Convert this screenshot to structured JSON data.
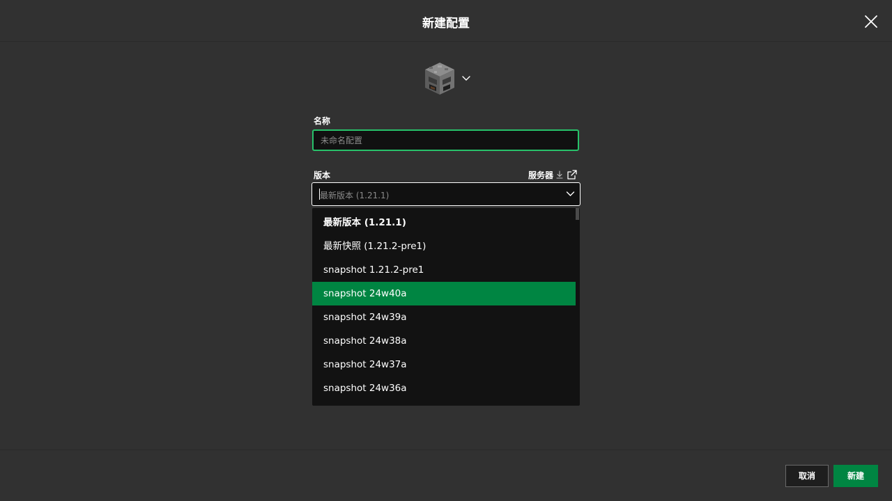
{
  "dialog": {
    "title": "新建配置"
  },
  "icons": {
    "close": "close-icon",
    "profile_block": "furnace-block-icon",
    "picker_chevron": "chevron-down-icon",
    "download": "download-icon",
    "external_link": "external-link-icon",
    "dropdown_chevron": "chevron-down-icon"
  },
  "form": {
    "name_label": "名称",
    "name_placeholder": "未命名配置",
    "name_value": "",
    "version_label": "版本",
    "server_label": "服务器",
    "version_placeholder": "最新版本 (1.21.1)"
  },
  "version_options": [
    {
      "label": "最新版本 (1.21.1)",
      "bold": true,
      "selected": false
    },
    {
      "label": "最新快照 (1.21.2-pre1)",
      "bold": false,
      "selected": false
    },
    {
      "label": "snapshot 1.21.2-pre1",
      "bold": false,
      "selected": false
    },
    {
      "label": "snapshot 24w40a",
      "bold": false,
      "selected": true
    },
    {
      "label": "snapshot 24w39a",
      "bold": false,
      "selected": false
    },
    {
      "label": "snapshot 24w38a",
      "bold": false,
      "selected": false
    },
    {
      "label": "snapshot 24w37a",
      "bold": false,
      "selected": false
    },
    {
      "label": "snapshot 24w36a",
      "bold": false,
      "selected": false
    }
  ],
  "footer": {
    "cancel_label": "取消",
    "create_label": "新建"
  },
  "colors": {
    "background": "#313131",
    "accent_green": "#27c26a",
    "selected_green": "#008542",
    "input_background": "#111111"
  }
}
